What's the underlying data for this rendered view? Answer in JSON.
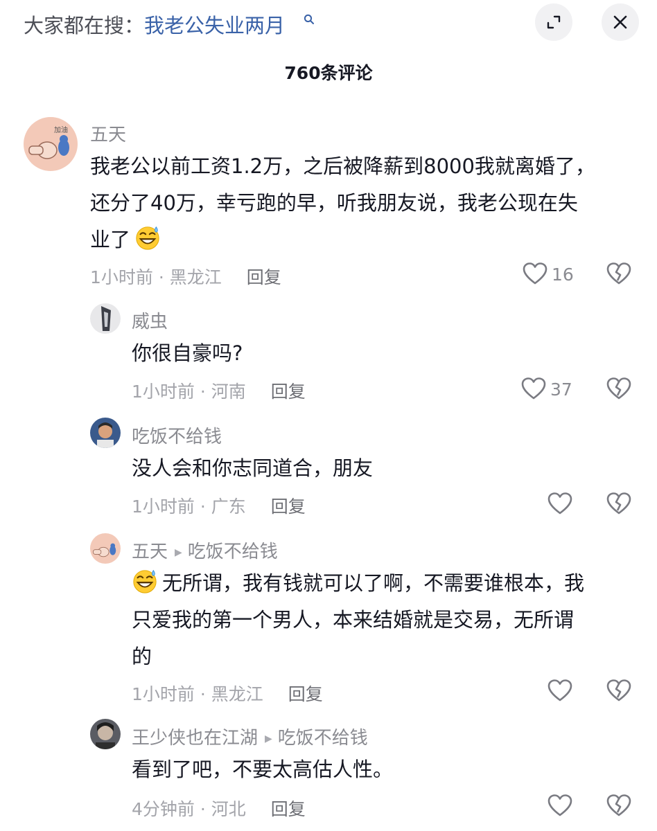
{
  "header": {
    "search_prefix": "大家都在搜：",
    "search_query": "我老公失业两月",
    "comment_count_title": "760条评论"
  },
  "comments": [
    {
      "author": "五天",
      "lines": [
        "我老公以前工资1.2万，之后被降薪到8000我就离婚了，",
        "还分了40万，幸亏跑的早，听我朋友说，我老公现在失",
        "业了"
      ],
      "time": "1小时前",
      "location": "黑龙江",
      "reply_label": "回复",
      "likes": "16"
    },
    {
      "author": "威虫",
      "lines": [
        "你很自豪吗?"
      ],
      "time": "1小时前",
      "location": "河南",
      "reply_label": "回复",
      "likes": "37"
    },
    {
      "author": "吃饭不给钱",
      "lines": [
        "没人会和你志同道合，朋友"
      ],
      "time": "1小时前",
      "location": "广东",
      "reply_label": "回复",
      "likes": ""
    },
    {
      "author": "五天",
      "reply_to": "吃饭不给钱",
      "lines": [
        "无所谓，我有钱就可以了啊，不需要谁根本，我",
        "只爱我的第一个男人，本来结婚就是交易，无所谓",
        "的"
      ],
      "time": "1小时前",
      "location": "黑龙江",
      "reply_label": "回复",
      "likes": ""
    },
    {
      "author": "王少侠也在江湖",
      "reply_to": "吃饭不给钱",
      "lines": [
        "看到了吧，不要太高估人性。"
      ],
      "time": "4分钟前",
      "location": "河北",
      "reply_label": "回复",
      "likes": ""
    }
  ],
  "icons": {
    "search": "search-icon",
    "expand": "expand-icon",
    "close": "close-icon",
    "like": "heart-icon",
    "dislike": "broken-heart-icon",
    "emoji": "grinning-sweat-emoji-icon"
  },
  "colors": {
    "link": "#3a62a8",
    "text": "#161823",
    "muted": "#a3a4aa",
    "button_bg": "#f1f1f3"
  }
}
